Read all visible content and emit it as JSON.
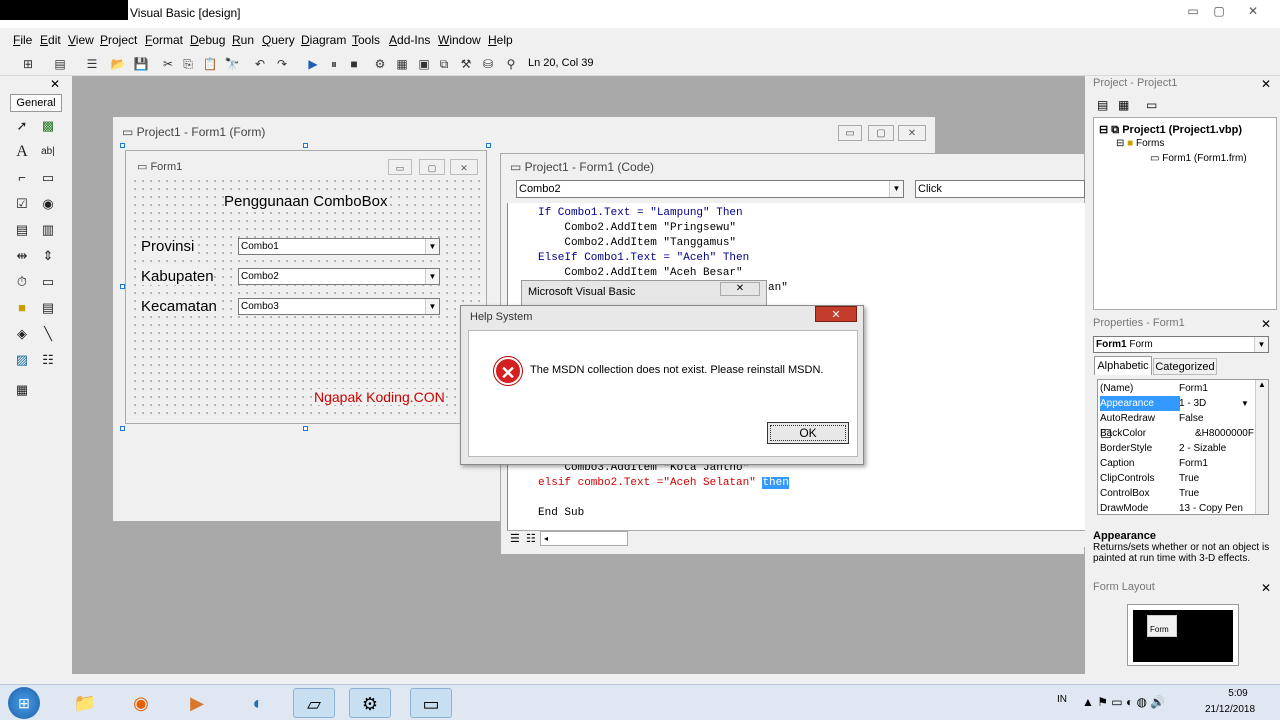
{
  "window": {
    "title": "Visual Basic [design]",
    "controls": [
      "▭",
      "▢",
      "✕"
    ]
  },
  "menu": [
    "File",
    "Edit",
    "View",
    "Project",
    "Format",
    "Debug",
    "Run",
    "Query",
    "Diagram",
    "Tools",
    "Add-Ins",
    "Window",
    "Help"
  ],
  "toolbar": {
    "position": "Ln 20, Col 39"
  },
  "toolbox": {
    "tab": "General",
    "close": "✕"
  },
  "form_designer": {
    "title": "Project1 - Form1 (Form)",
    "form": {
      "title": "Form1",
      "heading": "Penggunaan ComboBox",
      "labels": [
        "Provinsi",
        "Kabupaten",
        "Kecamatan"
      ],
      "combos": [
        "Combo1",
        "Combo2",
        "Combo3"
      ],
      "watermark": "Ngapak Koding.CON"
    }
  },
  "code_window": {
    "title": "Project1 - Form1 (Code)",
    "object_select": "Combo2",
    "procedure_select": "Click",
    "lines": [
      [
        "If Combo1.Text = \"Lampung\" Then",
        "kw"
      ],
      [
        "    Combo2.AddItem \"Pringsewu\"",
        ""
      ],
      [
        "    Combo2.AddItem \"Tanggamus\"",
        ""
      ],
      [
        "ElseIf Combo1.Text = \"Aceh\" Then",
        "kw"
      ],
      [
        "    Combo2.AddItem \"Aceh Besar\"",
        ""
      ]
    ],
    "partial_text": "an\"",
    "lower_lines": [
      "    Combo3.AddItem \"Kota Jantho\""
    ],
    "error_line": "elsif combo2.Text =\"Aceh Selatan\" ",
    "error_highlight": "then",
    "end_sub": "End Sub"
  },
  "msvb_dialog": {
    "title": "Microsoft Visual Basic",
    "close": "✕"
  },
  "help_dialog": {
    "title": "Help System",
    "message": "The MSDN collection does not exist. Please reinstall MSDN.",
    "ok_label": "OK",
    "close": "✕"
  },
  "project_panel": {
    "title": "Project - Project1",
    "tree": {
      "root": "Project1 (Project1.vbp)",
      "folder": "Forms",
      "item": "Form1 (Form1.frm)"
    }
  },
  "properties_panel": {
    "title": "Properties - Form1",
    "object": "Form1",
    "object_type": "Form",
    "tabs": [
      "Alphabetic",
      "Categorized"
    ],
    "rows": [
      {
        "name": "(Name)",
        "value": "Form1"
      },
      {
        "name": "Appearance",
        "value": "1 - 3D"
      },
      {
        "name": "AutoRedraw",
        "value": "False"
      },
      {
        "name": "BackColor",
        "value": "&H8000000F"
      },
      {
        "name": "BorderStyle",
        "value": "2 - Sizable"
      },
      {
        "name": "Caption",
        "value": "Form1"
      },
      {
        "name": "ClipControls",
        "value": "True"
      },
      {
        "name": "ControlBox",
        "value": "True"
      },
      {
        "name": "DrawMode",
        "value": "13 - Copy Pen"
      }
    ],
    "selected_index": 1,
    "desc_title": "Appearance",
    "desc_text": "Returns/sets whether or not an object is painted at run time with 3-D effects."
  },
  "form_layout": {
    "title": "Form Layout",
    "mini_label": "Form"
  },
  "taskbar": {
    "language": "IN",
    "time": "5:09",
    "date": "21/12/2018"
  },
  "colors": {
    "selection": "#3399ff",
    "keyword": "#00008b",
    "error_red": "#cc0000",
    "watermark": "#cc0000"
  }
}
